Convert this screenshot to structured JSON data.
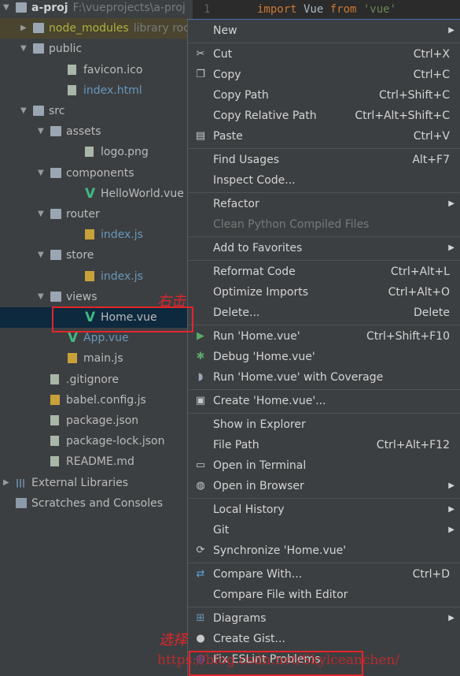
{
  "editor": {
    "line_number": "1",
    "code": [
      {
        "t": "import",
        "c": "#cc7832"
      },
      {
        "t": " Vue ",
        "c": "#a9b7c6"
      },
      {
        "t": "from",
        "c": "#cc7832"
      },
      {
        "t": " 'vue'",
        "c": "#6a8759"
      }
    ]
  },
  "tree": [
    {
      "label": "a-proj",
      "hint": "F:\\vueprojects\\a-proj",
      "level": 0,
      "arrow": "down",
      "icon": "folder",
      "bold": true
    },
    {
      "label": "node_modules",
      "hint": "library root",
      "level": 1,
      "arrow": "right",
      "icon": "folder",
      "color": "#b0b040",
      "highlight": true
    },
    {
      "label": "public",
      "level": 1,
      "arrow": "down",
      "icon": "folder"
    },
    {
      "label": "favicon.ico",
      "level": 2,
      "icon": "file"
    },
    {
      "label": "index.html",
      "level": 2,
      "icon": "file",
      "color": "#6897bb"
    },
    {
      "label": "src",
      "level": 1,
      "arrow": "down",
      "icon": "folder"
    },
    {
      "label": "assets",
      "level": 2,
      "arrow": "down",
      "icon": "folder"
    },
    {
      "label": "logo.png",
      "level": 3,
      "icon": "file"
    },
    {
      "label": "components",
      "level": 2,
      "arrow": "down",
      "icon": "folder"
    },
    {
      "label": "HelloWorld.vue",
      "level": 3,
      "icon": "vue"
    },
    {
      "label": "router",
      "level": 2,
      "arrow": "down",
      "icon": "folder"
    },
    {
      "label": "index.js",
      "level": 3,
      "icon": "js",
      "color": "#6897bb"
    },
    {
      "label": "store",
      "level": 2,
      "arrow": "down",
      "icon": "folder"
    },
    {
      "label": "index.js",
      "level": 3,
      "icon": "js",
      "color": "#6897bb"
    },
    {
      "label": "views",
      "level": 2,
      "arrow": "down",
      "icon": "folder"
    },
    {
      "label": "Home.vue",
      "level": 3,
      "icon": "vue",
      "selected": true
    },
    {
      "label": "App.vue",
      "level": 2,
      "icon": "vue",
      "color": "#6897bb"
    },
    {
      "label": "main.js",
      "level": 2,
      "icon": "js"
    },
    {
      "label": ".gitignore",
      "level": 1,
      "icon": "file"
    },
    {
      "label": "babel.config.js",
      "level": 1,
      "icon": "js"
    },
    {
      "label": "package.json",
      "level": 1,
      "icon": "file"
    },
    {
      "label": "package-lock.json",
      "level": 1,
      "icon": "file"
    },
    {
      "label": "README.md",
      "level": 1,
      "icon": "file"
    },
    {
      "label": "External Libraries",
      "level": 0,
      "arrow": "right",
      "icon": "library"
    },
    {
      "label": "Scratches and Consoles",
      "level": 0,
      "icon": "scratch"
    }
  ],
  "menu": [
    [
      {
        "label": "New",
        "submenu": true
      }
    ],
    [
      {
        "label": "Cut",
        "shortcut": "Ctrl+X",
        "icon": "scissors"
      },
      {
        "label": "Copy",
        "shortcut": "Ctrl+C",
        "icon": "copy"
      },
      {
        "label": "Copy Path",
        "shortcut": "Ctrl+Shift+C"
      },
      {
        "label": "Copy Relative Path",
        "shortcut": "Ctrl+Alt+Shift+C"
      },
      {
        "label": "Paste",
        "shortcut": "Ctrl+V",
        "icon": "paste"
      }
    ],
    [
      {
        "label": "Find Usages",
        "shortcut": "Alt+F7"
      },
      {
        "label": "Inspect Code..."
      }
    ],
    [
      {
        "label": "Refactor",
        "submenu": true
      },
      {
        "label": "Clean Python Compiled Files",
        "disabled": true
      }
    ],
    [
      {
        "label": "Add to Favorites",
        "submenu": true
      }
    ],
    [
      {
        "label": "Reformat Code",
        "shortcut": "Ctrl+Alt+L"
      },
      {
        "label": "Optimize Imports",
        "shortcut": "Ctrl+Alt+O"
      },
      {
        "label": "Delete...",
        "shortcut": "Delete"
      }
    ],
    [
      {
        "label": "Run 'Home.vue'",
        "shortcut": "Ctrl+Shift+F10",
        "icon": "run"
      },
      {
        "label": "Debug 'Home.vue'",
        "icon": "debug"
      },
      {
        "label": "Run 'Home.vue' with Coverage",
        "icon": "coverage"
      }
    ],
    [
      {
        "label": "Create 'Home.vue'...",
        "icon": "create-config"
      }
    ],
    [
      {
        "label": "Show in Explorer"
      },
      {
        "label": "File Path",
        "shortcut": "Ctrl+Alt+F12"
      },
      {
        "label": "Open in Terminal",
        "icon": "terminal"
      },
      {
        "label": "Open in Browser",
        "icon": "globe",
        "submenu": true
      }
    ],
    [
      {
        "label": "Local History",
        "submenu": true
      },
      {
        "label": "Git",
        "submenu": true
      },
      {
        "label": "Synchronize 'Home.vue'",
        "icon": "sync"
      }
    ],
    [
      {
        "label": "Compare With...",
        "shortcut": "Ctrl+D",
        "icon": "compare"
      },
      {
        "label": "Compare File with Editor"
      }
    ],
    [
      {
        "label": "Diagrams",
        "icon": "diagram",
        "submenu": true
      },
      {
        "label": "Create Gist...",
        "icon": "github"
      },
      {
        "label": "Fix ESLint Problems",
        "icon": "eslint"
      }
    ]
  ],
  "annotations": {
    "right_click": "右击",
    "select": "选择",
    "watermark": "https://blog.csdn.net/Skylceanchen/"
  },
  "colors": {
    "selection": "#0d293e",
    "annotation": "#e0262b",
    "menu_bg": "#3c3f41"
  }
}
